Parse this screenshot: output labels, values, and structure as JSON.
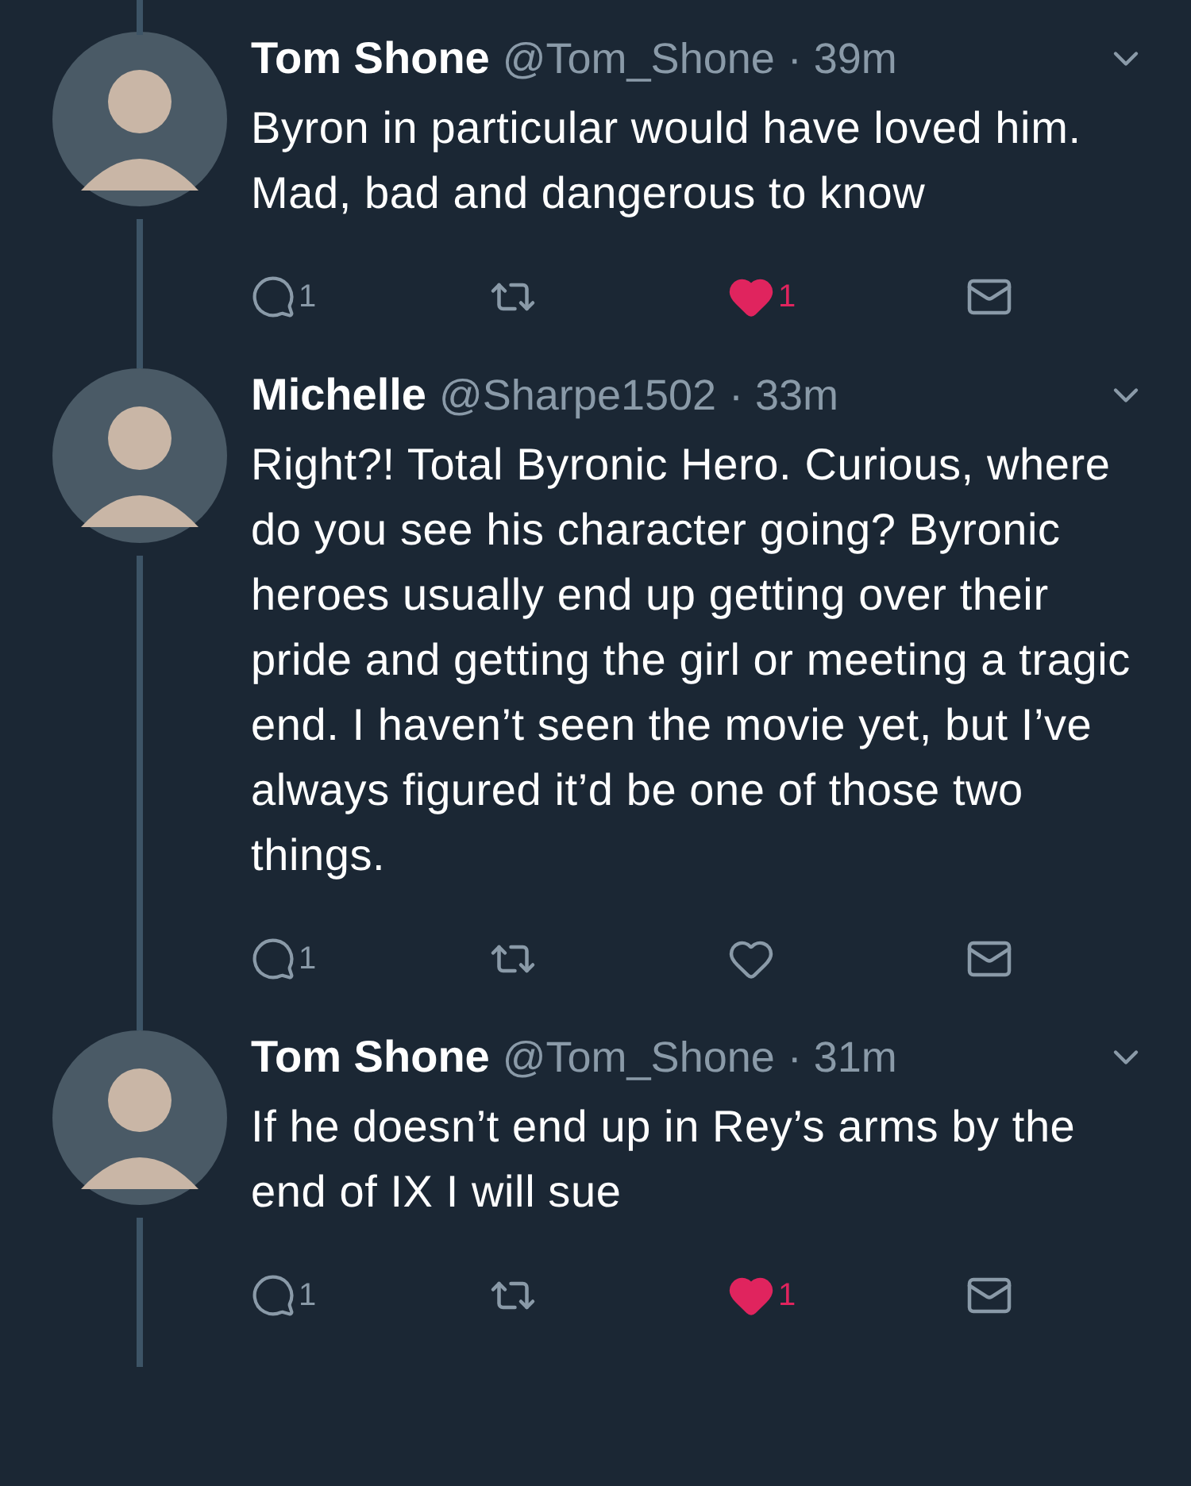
{
  "tweets": [
    {
      "name": "Tom Shone",
      "handle": "@Tom_Shone",
      "time": "· 39m",
      "text": "Byron in particular would have loved him. Mad, bad and dangerous to know",
      "replies": "1",
      "liked": true,
      "likes": "1"
    },
    {
      "name": "Michelle",
      "handle": "@Sharpe1502",
      "time": "· 33m",
      "text": "Right?! Total Byronic Hero. Curious, where do you see his character going? Byronic heroes usually end up getting over their pride and getting the girl or meeting a tragic end. I haven’t seen the movie yet, but I’ve always figured it’d be one of those two things.",
      "replies": "1",
      "liked": false
    },
    {
      "name": "Tom Shone",
      "handle": "@Tom_Shone",
      "time": "· 31m",
      "text": "If he doesn’t end up in Rey’s arms by the end of IX I will sue",
      "replies": "1",
      "liked": true,
      "likes": "1"
    }
  ]
}
